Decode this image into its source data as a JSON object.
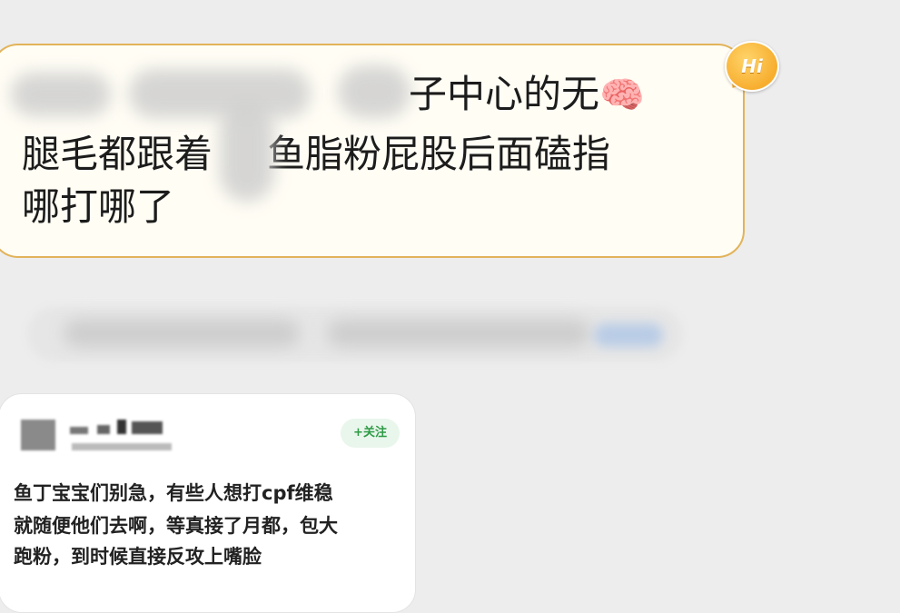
{
  "chat_bubble": {
    "line1": "子中心的无",
    "brain_emoji": "🧠",
    "line2_before": "腿毛都跟着",
    "line2_after": "鱼脂粉屁股后面磕指",
    "line3": "哪打哪了"
  },
  "badge": {
    "text": "Hi",
    "icon": "hi-bubble-icon"
  },
  "shared_post": {
    "follow_label": "+关注",
    "content_lines": [
      "鱼丁宝宝们别急，有些人想打cpf维稳",
      "就随便他们去啊，等真接了月都，包大",
      "跑粉，到时候直接反攻上嘴脸"
    ]
  },
  "colors": {
    "background": "#ededed",
    "bubble_bg": "#fffdf4",
    "bubble_border": "#e2b35a",
    "follow_green": "#2e9b45"
  }
}
